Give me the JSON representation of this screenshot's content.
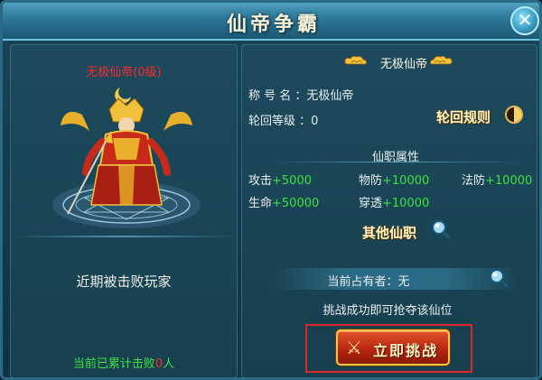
{
  "window": {
    "title": "仙帝争霸",
    "close_label": "✕"
  },
  "left": {
    "hero_name": "无极仙帝(0级)",
    "defeated_title": "近期被击败玩家",
    "defeat_count_prefix": "当前已累计击败",
    "defeat_count_value": "0",
    "defeat_count_suffix": "人"
  },
  "right": {
    "seat_name": "无极仙帝",
    "title_label": "称 号 名 ：",
    "title_value": "无极仙帝",
    "rebirth_label": "轮回等级 ：",
    "rebirth_value": "0",
    "rules_link": "轮回规则",
    "attr_title": "仙职属性",
    "attributes": [
      {
        "label": "攻击",
        "value": "+5000"
      },
      {
        "label": "物防",
        "value": "+10000"
      },
      {
        "label": "法防",
        "value": "+10000"
      },
      {
        "label": "生命",
        "value": "+50000"
      },
      {
        "label": "穿透",
        "value": "+10000"
      }
    ],
    "other_link": "其他仙职",
    "holder_text": "当前占有者：无",
    "hint_text": "挑战成功即可抢夺该仙位",
    "challenge_label": "立即挑战"
  },
  "colors": {
    "accent_green": "#3fe040",
    "accent_red": "#ff2a2a",
    "highlight_border": "#e0262a",
    "button_gold": "#f4c64a"
  },
  "icons": [
    "close-icon",
    "cloud-icon",
    "yinyang-icon",
    "search-icon",
    "sword-icon"
  ]
}
